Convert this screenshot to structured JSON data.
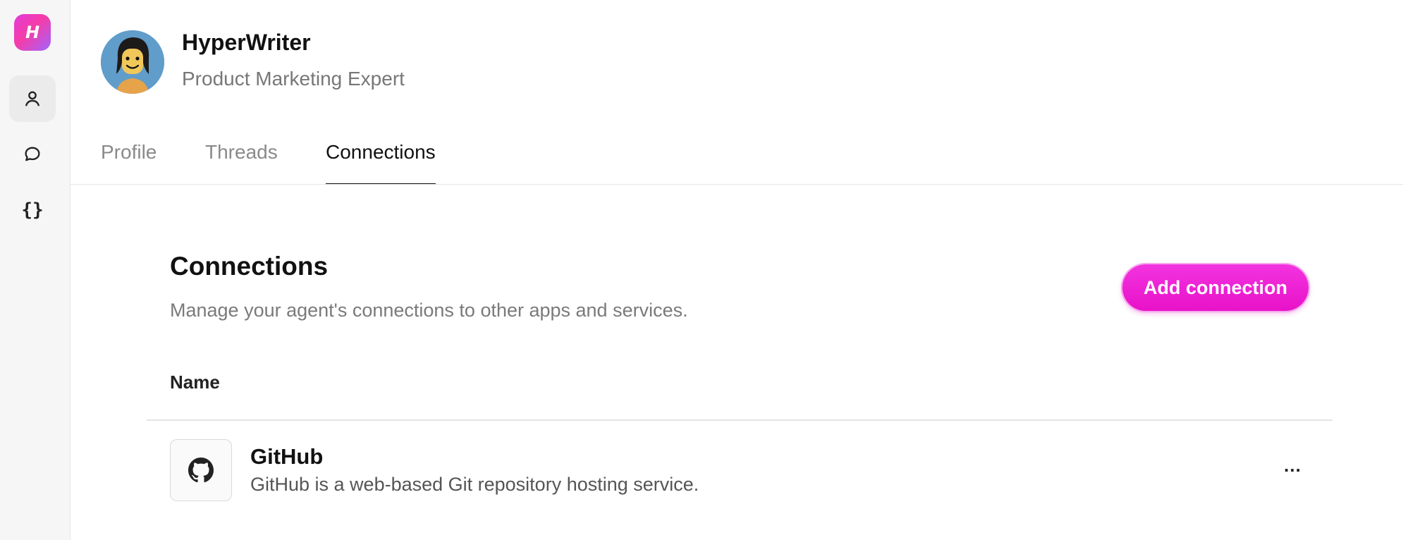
{
  "sidebar": {
    "logo_letter": "H",
    "items": [
      {
        "icon": "user-icon",
        "active": true
      },
      {
        "icon": "chat-bubble-icon",
        "active": false
      },
      {
        "icon": "code-braces-icon",
        "active": false,
        "glyph": "{}"
      }
    ]
  },
  "header": {
    "agent_name": "HyperWriter",
    "agent_role": "Product Marketing Expert"
  },
  "tabs": [
    {
      "label": "Profile",
      "active": false
    },
    {
      "label": "Threads",
      "active": false
    },
    {
      "label": "Connections",
      "active": true
    }
  ],
  "connections": {
    "title": "Connections",
    "description": "Manage your agent's connections to other apps and services.",
    "add_button_label": "Add connection",
    "columns": [
      "Name"
    ],
    "rows": [
      {
        "icon": "github-icon",
        "name": "GitHub",
        "description": "GitHub is a web-based Git repository hosting service.",
        "menu_glyph": "…"
      }
    ]
  },
  "colors": {
    "accent": "#ee1fd2",
    "sidebar_bg": "#f6f6f6",
    "text_muted": "#7a7a7a"
  }
}
